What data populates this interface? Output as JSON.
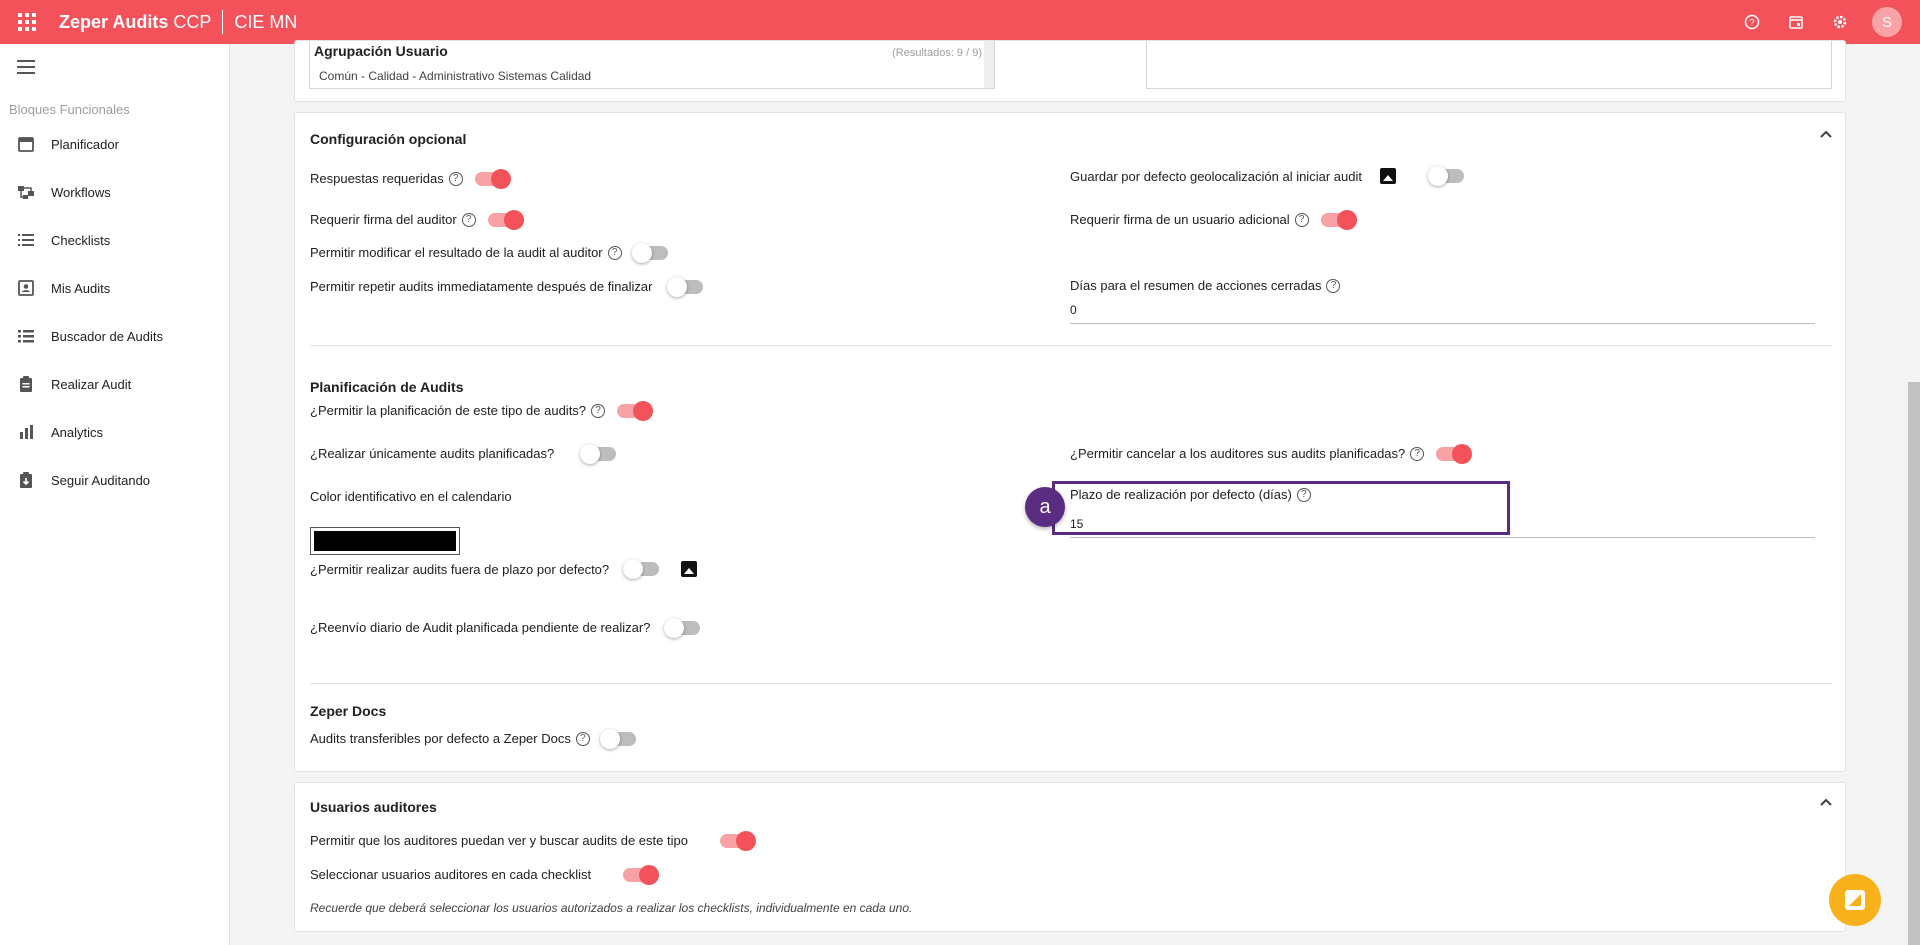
{
  "topbar": {
    "app_name": "Zeper Audits",
    "app_suffix": "CCP",
    "company": "CIE MN",
    "avatar_letter": "S"
  },
  "sidebar": {
    "section": "Bloques Funcionales",
    "items": [
      {
        "label": "Planificador",
        "icon": "calendar-icon"
      },
      {
        "label": "Workflows",
        "icon": "workflow-icon"
      },
      {
        "label": "Checklists",
        "icon": "list-icon"
      },
      {
        "label": "Mis Audits",
        "icon": "user-card-icon"
      },
      {
        "label": "Buscador de Audits",
        "icon": "search-list-icon"
      },
      {
        "label": "Realizar Audit",
        "icon": "clipboard-icon"
      },
      {
        "label": "Analytics",
        "icon": "bar-chart-icon"
      },
      {
        "label": "Seguir Auditando",
        "icon": "download-clipboard-icon"
      }
    ]
  },
  "top_card": {
    "title": "Agrupación Usuario",
    "results": "(Resultados: 9 / 9)",
    "value": "Común - Calidad - Administrativo Sistemas Calidad"
  },
  "config": {
    "title": "Configuración opcional",
    "respuestas": "Respuestas requeridas",
    "firma_auditor": "Requerir firma del auditor",
    "modificar_resultado": "Permitir modificar el resultado de la audit al auditor",
    "repetir_audits": "Permitir repetir audits immediatamente después de finalizar",
    "geolocalizacion": "Guardar por defecto geolocalización al iniciar audit",
    "firma_adicional": "Requerir firma de un usuario adicional",
    "dias_resumen_label": "Días para el resumen de acciones cerradas",
    "dias_resumen_value": "0"
  },
  "planificacion": {
    "title": "Planificación de Audits",
    "permitir_planificacion": "¿Permitir la planificación de este tipo de audits?",
    "realizar_unicamente": "¿Realizar únicamente audits planificadas?",
    "permitir_cancelar": "¿Permitir cancelar a los auditores sus audits planificadas?",
    "badge": "a",
    "color_label": "Color identificativo en el calendario",
    "plazo_label": "Plazo de realización por defecto (días)",
    "plazo_value": "15",
    "fuera_plazo": "¿Permitir realizar audits fuera de plazo por defecto?",
    "reenvio": "¿Reenvío diario de Audit planificada pendiente de realizar?"
  },
  "zeper_docs": {
    "title": "Zeper Docs",
    "transferibles": "Audits transferibles por defecto a Zeper Docs"
  },
  "usuarios": {
    "title": "Usuarios auditores",
    "ver_buscar": "Permitir que los auditores puedan ver y buscar audits de este tipo",
    "seleccionar": "Seleccionar usuarios auditores en cada checklist",
    "note": "Recuerde que deberá seleccionar los usuarios autorizados a realizar los checklists, individualmente en cada uno."
  },
  "colors": {
    "brand": "#f4525a",
    "highlight": "#5a2d82",
    "fab": "#f7b21b"
  }
}
